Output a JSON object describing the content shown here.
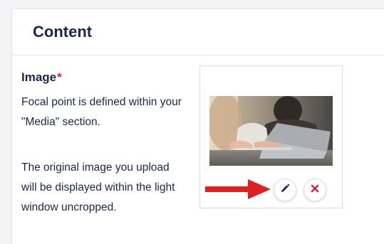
{
  "panel": {
    "title": "Content"
  },
  "field": {
    "label": "Image",
    "required_marker": "*",
    "description_1": "Focal point is defined within your \"Media\" section.",
    "description_2": "The original image you upload will be displayed within the light window uncropped."
  },
  "media": {
    "edit_icon": "pencil-icon",
    "remove_icon": "close-icon"
  },
  "colors": {
    "text": "#1b264f",
    "required": "#d42054",
    "remove": "#d42054",
    "annotation_arrow": "#e02020"
  }
}
